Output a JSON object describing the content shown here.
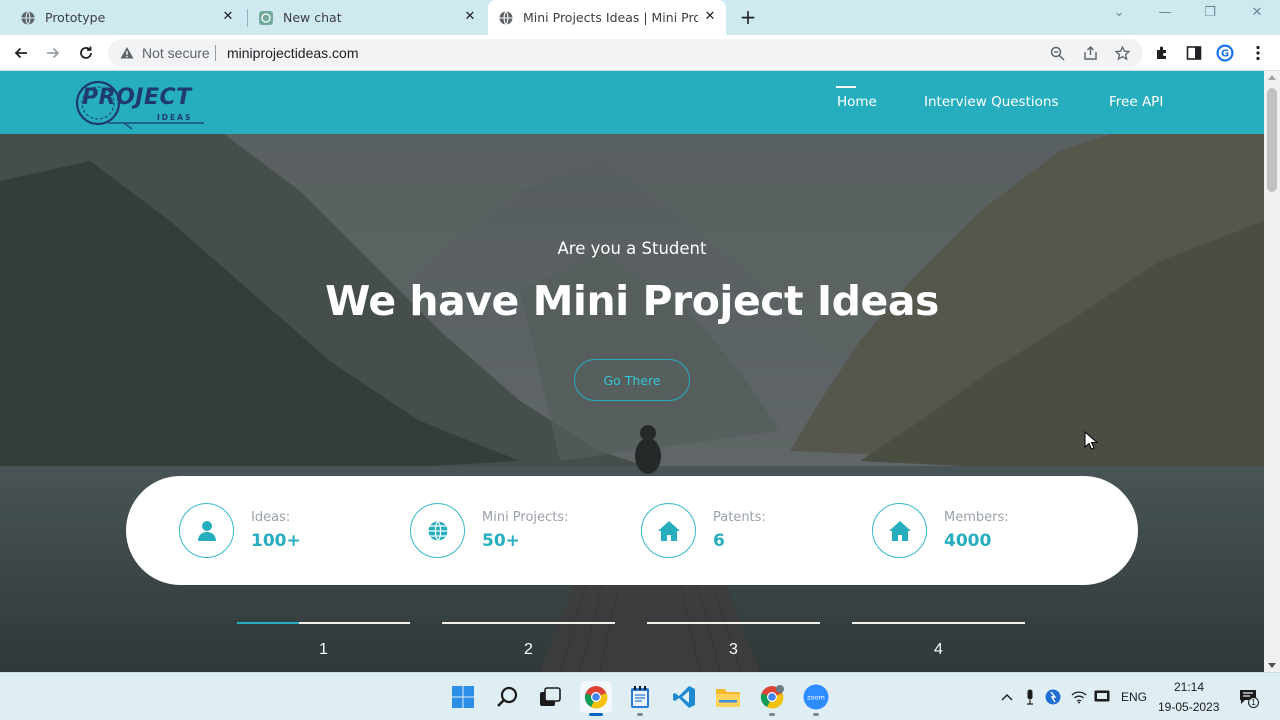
{
  "browser": {
    "tabs": [
      {
        "title": "Prototype",
        "icon": "globe-icon"
      },
      {
        "title": "New chat",
        "icon": "chatgpt-icon"
      },
      {
        "title": "Mini Projects Ideas | Mini Project",
        "icon": "globe-icon",
        "active": true
      }
    ],
    "address": {
      "security_label": "Not secure",
      "url": "miniprojectideas.com"
    }
  },
  "site": {
    "logo": {
      "line1": "PROJECT",
      "line2": "IDEAS"
    },
    "nav": [
      {
        "label": "Home",
        "active": true
      },
      {
        "label": "Interview Questions"
      },
      {
        "label": "Free API"
      }
    ],
    "hero": {
      "subtitle": "Are you a Student",
      "title": "We have Mini Project Ideas",
      "button": "Go There"
    },
    "stats": [
      {
        "label": "Ideas:",
        "value": "100+",
        "icon": "user-icon"
      },
      {
        "label": "Mini Projects:",
        "value": "50+",
        "icon": "globe-icon"
      },
      {
        "label": "Patents:",
        "value": "6",
        "icon": "home-icon"
      },
      {
        "label": "Members:",
        "value": "4000",
        "icon": "home-icon"
      }
    ],
    "slides": [
      {
        "number": "1",
        "progress": 0.36
      },
      {
        "number": "2",
        "progress": 0
      },
      {
        "number": "3",
        "progress": 0
      },
      {
        "number": "4",
        "progress": 0
      }
    ],
    "colors": {
      "accent": "#27aebe"
    }
  },
  "taskbar": {
    "language": "ENG",
    "time": "21:14",
    "date": "19-05-2023",
    "notification_count": "1"
  }
}
